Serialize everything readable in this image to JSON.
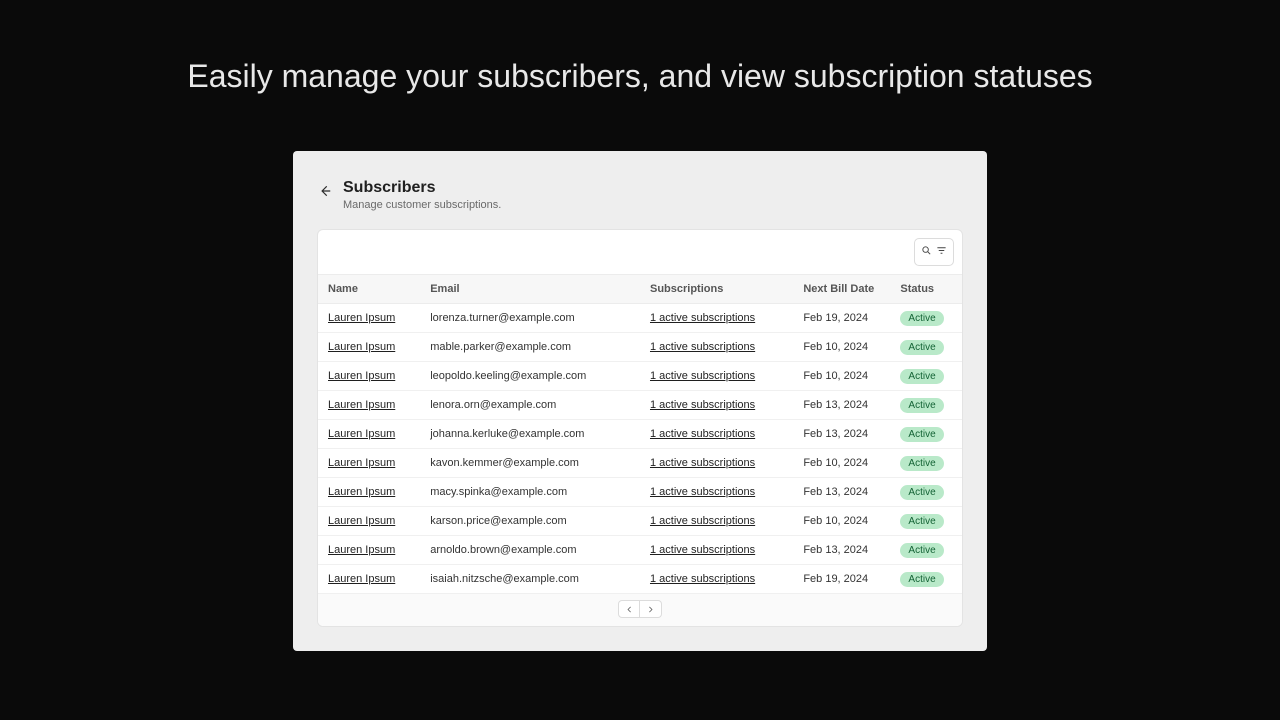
{
  "hero": "Easily manage your subscribers, and view subscription statuses",
  "header": {
    "title": "Subscribers",
    "subtitle": "Manage customer subscriptions."
  },
  "columns": {
    "name": "Name",
    "email": "Email",
    "subscriptions": "Subscriptions",
    "next_bill": "Next Bill Date",
    "status": "Status"
  },
  "rows": [
    {
      "name": "Lauren Ipsum",
      "email": "lorenza.turner@example.com",
      "subs": "1 active subscriptions",
      "date": "Feb 19, 2024",
      "status": "Active"
    },
    {
      "name": "Lauren Ipsum",
      "email": "mable.parker@example.com",
      "subs": "1 active subscriptions",
      "date": "Feb 10, 2024",
      "status": "Active"
    },
    {
      "name": "Lauren Ipsum",
      "email": "leopoldo.keeling@example.com",
      "subs": "1 active subscriptions",
      "date": "Feb 10, 2024",
      "status": "Active"
    },
    {
      "name": "Lauren Ipsum",
      "email": "lenora.orn@example.com",
      "subs": "1 active subscriptions",
      "date": "Feb 13, 2024",
      "status": "Active"
    },
    {
      "name": "Lauren Ipsum",
      "email": "johanna.kerluke@example.com",
      "subs": "1 active subscriptions",
      "date": "Feb 13, 2024",
      "status": "Active"
    },
    {
      "name": "Lauren Ipsum",
      "email": "kavon.kemmer@example.com",
      "subs": "1 active subscriptions",
      "date": "Feb 10, 2024",
      "status": "Active"
    },
    {
      "name": "Lauren Ipsum",
      "email": "macy.spinka@example.com",
      "subs": "1 active subscriptions",
      "date": "Feb 13, 2024",
      "status": "Active"
    },
    {
      "name": "Lauren Ipsum",
      "email": "karson.price@example.com",
      "subs": "1 active subscriptions",
      "date": "Feb 10, 2024",
      "status": "Active"
    },
    {
      "name": "Lauren Ipsum",
      "email": "arnoldo.brown@example.com",
      "subs": "1 active subscriptions",
      "date": "Feb 13, 2024",
      "status": "Active"
    },
    {
      "name": "Lauren Ipsum",
      "email": "isaiah.nitzsche@example.com",
      "subs": "1 active subscriptions",
      "date": "Feb 19, 2024",
      "status": "Active"
    }
  ]
}
